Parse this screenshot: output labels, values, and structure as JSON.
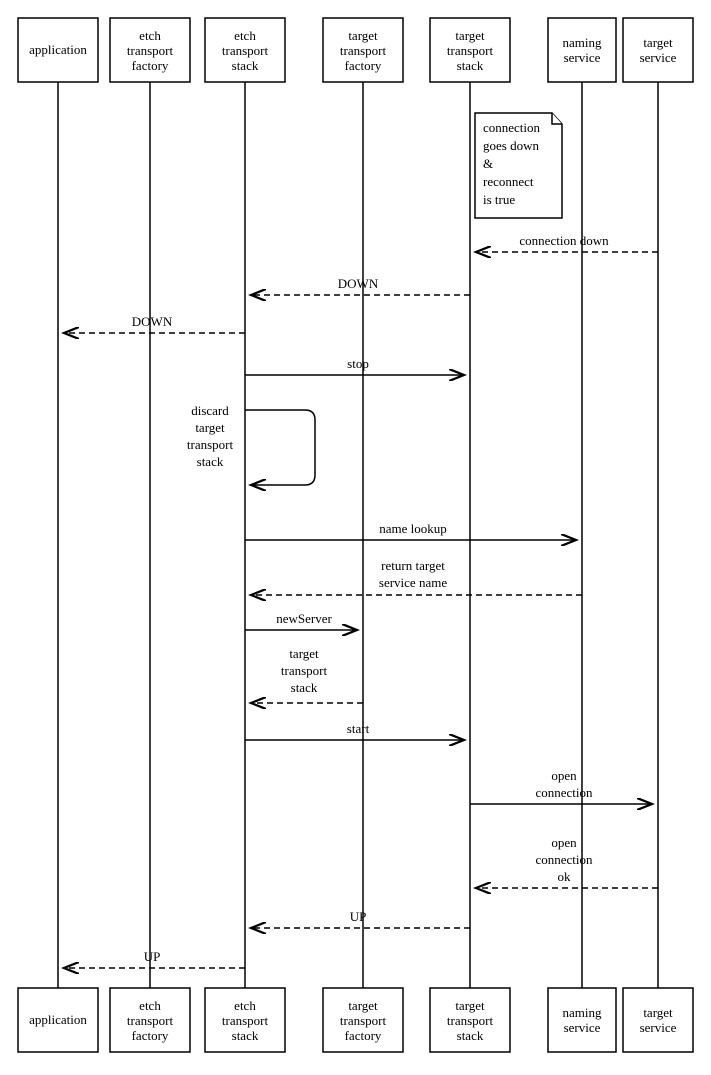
{
  "actors": {
    "application": "application",
    "etch_factory_l1": "etch",
    "etch_factory_l2": "transport",
    "etch_factory_l3": "factory",
    "etch_stack_l1": "etch",
    "etch_stack_l2": "transport",
    "etch_stack_l3": "stack",
    "target_factory_l1": "target",
    "target_factory_l2": "transport",
    "target_factory_l3": "factory",
    "target_stack_l1": "target",
    "target_stack_l2": "transport",
    "target_stack_l3": "stack",
    "naming_l1": "naming",
    "naming_l2": "service",
    "target_service_l1": "target",
    "target_service_l2": "service"
  },
  "note": {
    "l1": "connection",
    "l2": "goes down",
    "l3": "&",
    "l4": "reconnect",
    "l5": "is true"
  },
  "messages": {
    "conn_down": "connection down",
    "down1": "DOWN",
    "down2": "DOWN",
    "stop": "stop",
    "discard_l1": "discard",
    "discard_l2": "target",
    "discard_l3": "transport",
    "discard_l4": "stack",
    "name_lookup": "name lookup",
    "return_l1": "return target",
    "return_l2": "service name",
    "newserver": "newServer",
    "newserver_ret_l1": "target",
    "newserver_ret_l2": "transport",
    "newserver_ret_l3": "stack",
    "start": "start",
    "open_conn_l1": "open",
    "open_conn_l2": "connection",
    "open_ok_l1": "open",
    "open_ok_l2": "connection",
    "open_ok_l3": "ok",
    "up1": "UP",
    "up2": "UP"
  }
}
